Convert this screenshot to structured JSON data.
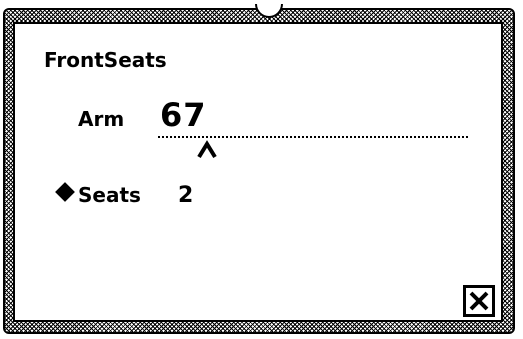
{
  "dialog": {
    "title": "FrontSeats",
    "field": {
      "label": "Arm",
      "value": "67"
    },
    "seats": {
      "label": "Seats",
      "value": "2"
    },
    "close_icon": "close-box-icon",
    "caret_icon": "insertion-caret-icon",
    "bullet_icon": "diamond-bullet-icon"
  }
}
